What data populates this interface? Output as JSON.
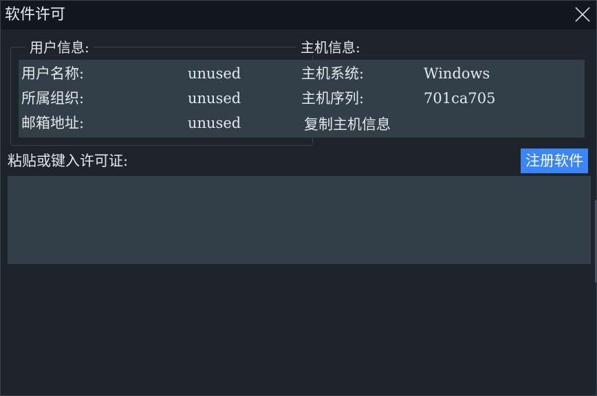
{
  "window": {
    "title": "软件许可",
    "close_icon": "close-icon"
  },
  "user_info": {
    "legend": "用户信息:",
    "rows": [
      {
        "label": "用户名称:",
        "value": "unused"
      },
      {
        "label": "所属组织:",
        "value": "unused"
      },
      {
        "label": "邮箱地址:",
        "value": "unused"
      }
    ]
  },
  "host_info": {
    "legend": "主机信息:",
    "rows": [
      {
        "label": "主机系统:",
        "value": "Windows"
      },
      {
        "label": "主机序列:",
        "value": "701ca705"
      }
    ],
    "copy_label": "复制主机信息"
  },
  "license": {
    "label": "粘贴或键入许可证:",
    "input_value": "",
    "register_label": "注册软件"
  },
  "colors": {
    "background": "#1d242b",
    "titlebar": "#131820",
    "panel": "#323e48",
    "accent": "#3b86f4"
  }
}
